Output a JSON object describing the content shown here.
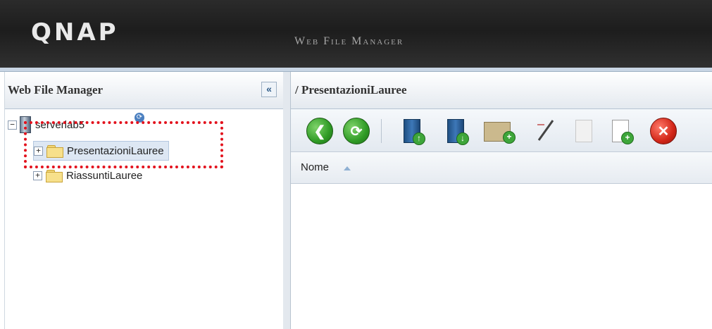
{
  "header": {
    "logo": "QNAP",
    "app_title": "Web File Manager"
  },
  "left_panel": {
    "title": "Web File Manager",
    "collapse_label": "«",
    "tree": {
      "root": {
        "label": "serverlab5",
        "toggle": "−"
      },
      "children": [
        {
          "label": "PresentazioniLauree",
          "toggle": "+"
        },
        {
          "label": "RiassuntiLauree",
          "toggle": "+"
        }
      ]
    }
  },
  "right_panel": {
    "path": "/ PresentazioniLauree",
    "toolbar": {
      "buttons": [
        "back-icon",
        "refresh-icon",
        "upload-icon",
        "download-icon",
        "new-folder-icon",
        "rename-icon",
        "copy-icon",
        "paste-icon",
        "delete-icon"
      ]
    },
    "grid": {
      "columns": [
        {
          "label": "Nome",
          "sort": "ascending"
        }
      ]
    }
  },
  "highlight_color": "#e3121d"
}
